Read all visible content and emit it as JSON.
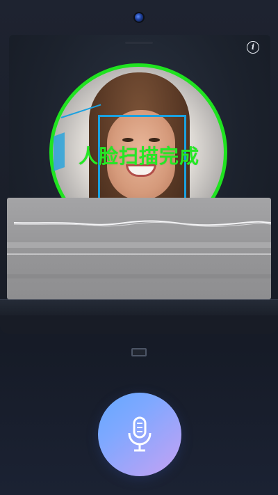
{
  "header": {
    "info_icon": "info-icon",
    "info_glyph": "i"
  },
  "scan": {
    "status_text": "人脸扫描完成",
    "ring_color": "#1fe31f",
    "box_color": "#1aa1e0"
  },
  "voice": {
    "mic_icon": "microphone-icon",
    "accent_gradient": [
      "#64a8ff",
      "#c6a1f3"
    ]
  }
}
